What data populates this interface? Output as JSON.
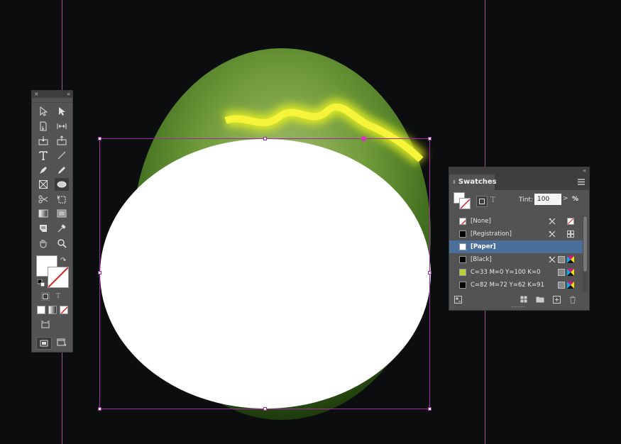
{
  "swatches_panel": {
    "tab_label": "Swatches",
    "tint_label": "Tint:",
    "tint_value": "100",
    "tint_arrow": ">",
    "tint_unit": "%",
    "rows": [
      {
        "name": "[None]",
        "chip": "none",
        "selected": false
      },
      {
        "name": "[Registration]",
        "chip": "#000000",
        "selected": false
      },
      {
        "name": "[Paper]",
        "chip": "#ffffff",
        "selected": true
      },
      {
        "name": "[Black]",
        "chip": "#000000",
        "selected": false
      },
      {
        "name": "C=33 M=0 Y=100 K=0",
        "chip": "#b5d334",
        "selected": false
      },
      {
        "name": "C=82 M=72 Y=62 K=91",
        "chip": "#050505",
        "selected": false
      }
    ]
  },
  "tools_panel": {
    "close_glyph": "×",
    "collapse_glyph": "«",
    "swap_glyph": "↷",
    "text_glyph": "T",
    "tools": [
      "selection-tool",
      "direct-selection-tool",
      "page-tool",
      "gap-tool",
      "content-collector-tool",
      "content-placer-tool",
      "type-tool",
      "line-tool",
      "pen-tool",
      "pencil-tool",
      "rectangle-frame-tool",
      "ellipse-tool",
      "scissors-tool",
      "free-transform-tool",
      "gradient-swatch-tool",
      "gradient-feather-tool",
      "note-tool",
      "eyedropper-tool",
      "hand-tool",
      "zoom-tool"
    ],
    "active_tool": "ellipse-tool"
  },
  "colors": {
    "canvas_bg": "#0c0d0f",
    "panel_bg": "#535353",
    "selection": "#a02aa0",
    "guide": "#a25a8a",
    "highlight_row": "#4a6f9a"
  }
}
